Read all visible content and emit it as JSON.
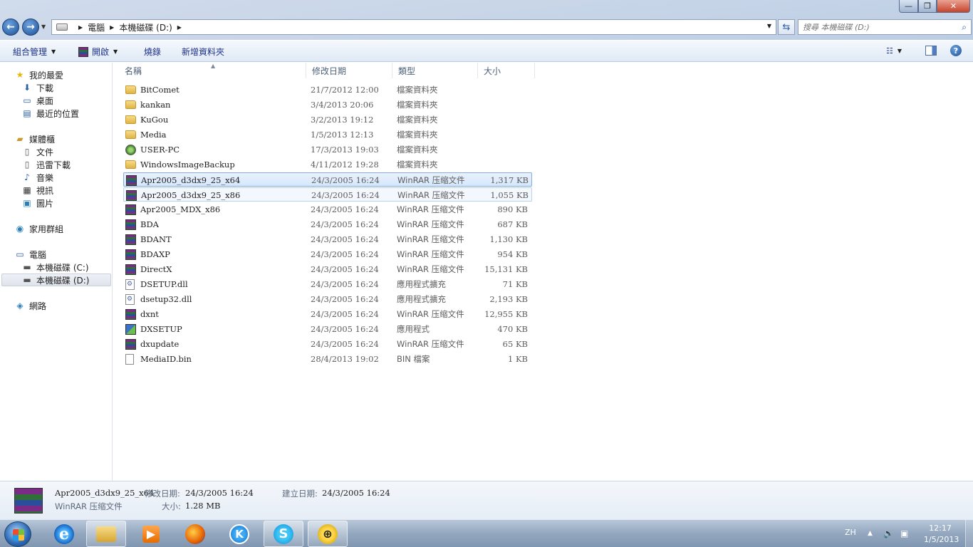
{
  "window": {
    "min_label": "—",
    "max_label": "❐",
    "close_label": "✕"
  },
  "address": {
    "crumbs": [
      "電腦",
      "本機磁碟 (D:)"
    ],
    "search_placeholder": "搜尋 本機磁碟 (D:)"
  },
  "toolbar": {
    "organize": "組合管理",
    "open": "開啟",
    "burn": "燒錄",
    "new_folder": "新增資料夾"
  },
  "nav": {
    "favorites": "我的最愛",
    "downloads": "下載",
    "desktop": "桌面",
    "recent": "最近的位置",
    "libraries": "媒體櫃",
    "documents": "文件",
    "xunlei": "迅雷下載",
    "music": "音樂",
    "videos": "視訊",
    "pictures": "圖片",
    "homegroup": "家用群組",
    "computer": "電腦",
    "drive_c": "本機磁碟 (C:)",
    "drive_d": "本機磁碟 (D:)",
    "network": "網路"
  },
  "columns": {
    "name": "名稱",
    "date": "修改日期",
    "type": "類型",
    "size": "大小"
  },
  "files": [
    {
      "icon": "folder",
      "name": "BitComet",
      "date": "21/7/2012 12:00",
      "type": "檔案資料夾",
      "size": ""
    },
    {
      "icon": "folder",
      "name": "kankan",
      "date": "3/4/2013 20:06",
      "type": "檔案資料夾",
      "size": ""
    },
    {
      "icon": "folder",
      "name": "KuGou",
      "date": "3/2/2013 19:12",
      "type": "檔案資料夾",
      "size": ""
    },
    {
      "icon": "folder",
      "name": "Media",
      "date": "1/5/2013 12:13",
      "type": "檔案資料夾",
      "size": ""
    },
    {
      "icon": "user",
      "name": "USER-PC",
      "date": "17/3/2013 19:03",
      "type": "檔案資料夾",
      "size": ""
    },
    {
      "icon": "folder",
      "name": "WindowsImageBackup",
      "date": "4/11/2012 19:28",
      "type": "檔案資料夾",
      "size": ""
    },
    {
      "icon": "rar",
      "name": "Apr2005_d3dx9_25_x64",
      "date": "24/3/2005 16:24",
      "type": "WinRAR 压缩文件",
      "size": "1,317 KB"
    },
    {
      "icon": "rar",
      "name": "Apr2005_d3dx9_25_x86",
      "date": "24/3/2005 16:24",
      "type": "WinRAR 压缩文件",
      "size": "1,055 KB"
    },
    {
      "icon": "rar",
      "name": "Apr2005_MDX_x86",
      "date": "24/3/2005 16:24",
      "type": "WinRAR 压缩文件",
      "size": "890 KB"
    },
    {
      "icon": "rar",
      "name": "BDA",
      "date": "24/3/2005 16:24",
      "type": "WinRAR 压缩文件",
      "size": "687 KB"
    },
    {
      "icon": "rar",
      "name": "BDANT",
      "date": "24/3/2005 16:24",
      "type": "WinRAR 压缩文件",
      "size": "1,130 KB"
    },
    {
      "icon": "rar",
      "name": "BDAXP",
      "date": "24/3/2005 16:24",
      "type": "WinRAR 压缩文件",
      "size": "954 KB"
    },
    {
      "icon": "rar",
      "name": "DirectX",
      "date": "24/3/2005 16:24",
      "type": "WinRAR 压缩文件",
      "size": "15,131 KB"
    },
    {
      "icon": "dll",
      "name": "DSETUP.dll",
      "date": "24/3/2005 16:24",
      "type": "應用程式擴充",
      "size": "71 KB"
    },
    {
      "icon": "dll",
      "name": "dsetup32.dll",
      "date": "24/3/2005 16:24",
      "type": "應用程式擴充",
      "size": "2,193 KB"
    },
    {
      "icon": "rar",
      "name": "dxnt",
      "date": "24/3/2005 16:24",
      "type": "WinRAR 压缩文件",
      "size": "12,955 KB"
    },
    {
      "icon": "exe",
      "name": "DXSETUP",
      "date": "24/3/2005 16:24",
      "type": "應用程式",
      "size": "470 KB"
    },
    {
      "icon": "rar",
      "name": "dxupdate",
      "date": "24/3/2005 16:24",
      "type": "WinRAR 压缩文件",
      "size": "65 KB"
    },
    {
      "icon": "bin",
      "name": "MediaID.bin",
      "date": "28/4/2013 19:02",
      "type": "BIN 檔案",
      "size": "1 KB"
    }
  ],
  "details": {
    "name": "Apr2005_d3dx9_25_x64",
    "type": "WinRAR 压缩文件",
    "modified_label": "修改日期:",
    "modified": "24/3/2005 16:24",
    "size_label": "大小:",
    "size": "1.28 MB",
    "created_label": "建立日期:",
    "created": "24/3/2005 16:24"
  },
  "taskbar": {
    "ie_glyph": "e",
    "kugou_glyph": "K",
    "skype_glyph": "S",
    "net_glyph": "⊕",
    "lang": "ZH",
    "time": "12:17",
    "date": "1/5/2013"
  }
}
